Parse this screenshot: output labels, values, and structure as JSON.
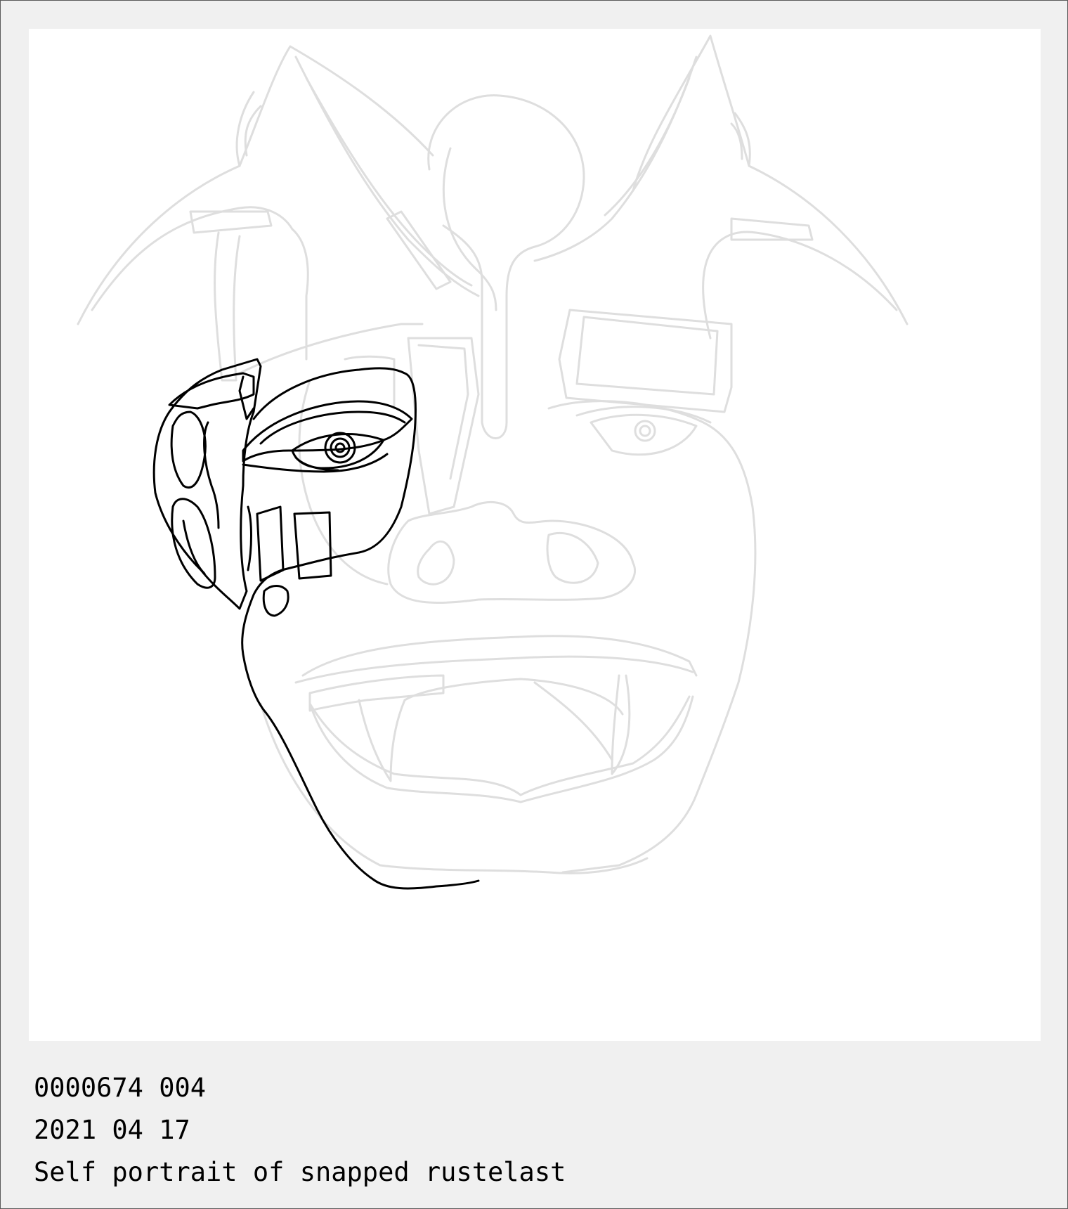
{
  "caption": {
    "code": "0000674 004",
    "date": "2021 04 17",
    "title": "Self portrait of snapped rustelast"
  },
  "colors": {
    "frame_background": "#f0f0f0",
    "canvas_background": "#ffffff",
    "sketch_faint": "#dedede",
    "sketch_ink": "#000000",
    "text": "#000000"
  }
}
